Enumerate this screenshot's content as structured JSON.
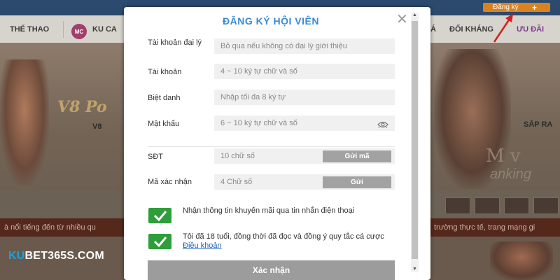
{
  "topbar": {
    "register_label": "Đăng ký",
    "register_plus": "+"
  },
  "nav": {
    "items": [
      "THỂ THAO",
      "KU CA",
      "Á",
      "ĐỐI KHÁNG",
      "ƯU ĐÃI"
    ],
    "casino_badge": "MC"
  },
  "hero": {
    "poker_logo": "V8 Po",
    "poker_sub": "V8",
    "right_text": "SẮP RA",
    "right_deco": "M v",
    "right_deco2": "anking"
  },
  "ticker": {
    "left_text": "à nổi tiếng đến từ nhiều qu",
    "right_text": "trường thực tế, trang mạng gi"
  },
  "brand": {
    "prefix": "KU",
    "name": "BET365S.COM"
  },
  "modal": {
    "title": "ĐĂNG KÝ HỘI VIÊN",
    "close_glyph": "✕",
    "fields": [
      {
        "label": "Tài khoản đại lý",
        "placeholder": "Bỏ qua nếu không có đại lý giới thiệu"
      },
      {
        "label": "Tài khoản",
        "placeholder": "4 ~ 10 ký tự chữ và số"
      },
      {
        "label": "Biệt danh",
        "placeholder": "Nhập tối đa 8 ký tự"
      },
      {
        "label": "Mật khẩu",
        "placeholder": "6 ~ 10 ký tự chữ và số"
      },
      {
        "label": "SĐT",
        "placeholder": "10 chữ số"
      },
      {
        "label": "Mã xác nhận",
        "placeholder": "4 Chữ số"
      }
    ],
    "send_code_label": "Gửi mã",
    "send_label": "Gửi",
    "consents": [
      {
        "text": "Nhận thông tin khuyến mãi qua tin nhắn điện thoại",
        "checked": true
      },
      {
        "text": "Tôi đã 18 tuổi, đồng thời đã đọc và đồng ý quy tắc cá cược",
        "link": "Điều khoản",
        "checked": true
      }
    ],
    "confirm_label": "Xác nhận"
  },
  "colors": {
    "title_blue": "#3a8ad0",
    "check_green": "#2d9e3a",
    "register_orange": "#d9831f",
    "brand_blue": "#1aa3e0"
  },
  "icons": [
    "close-icon",
    "eye-icon",
    "checkmark-icon",
    "plus-icon",
    "arrow-icon",
    "scroll-up-icon",
    "scroll-down-icon"
  ]
}
